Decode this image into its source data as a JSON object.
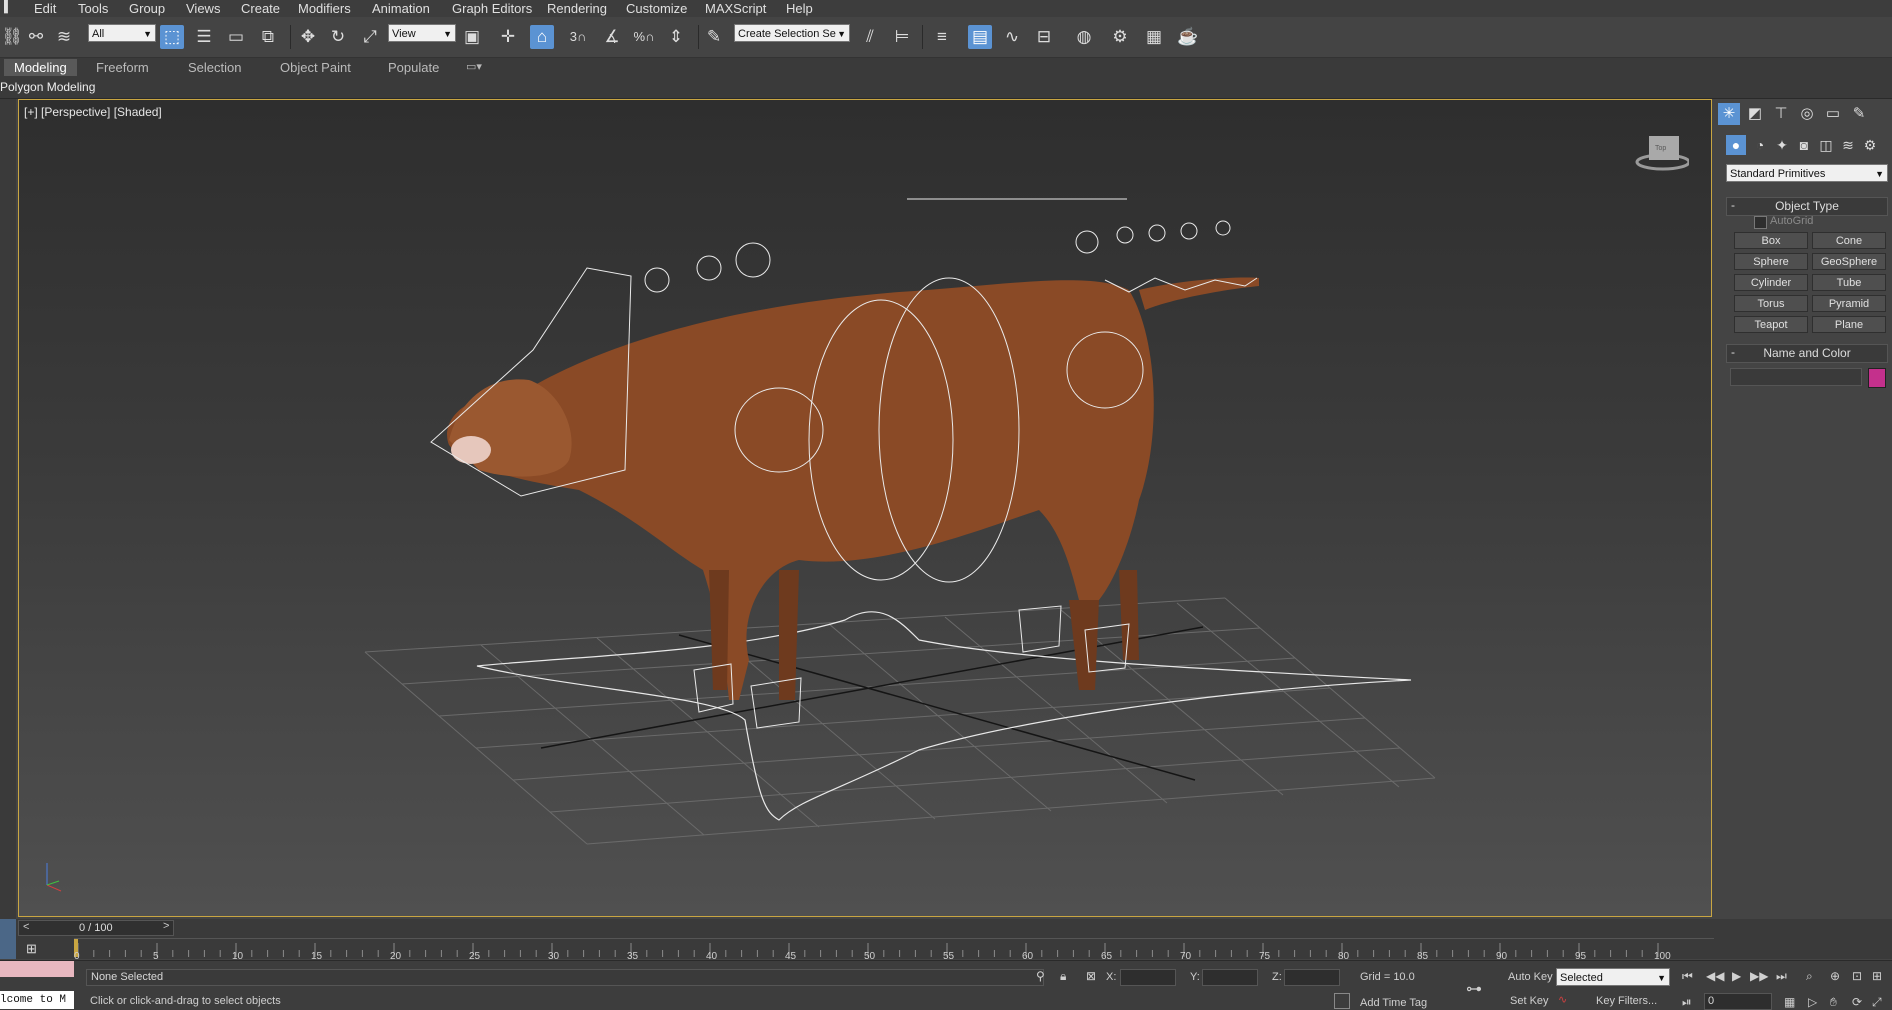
{
  "menu": {
    "items": [
      "Edit",
      "Tools",
      "Group",
      "Views",
      "Create",
      "Modifiers",
      "Animation",
      "Graph Editors",
      "Rendering",
      "Customize",
      "MAXScript",
      "Help"
    ]
  },
  "toolbar": {
    "selection_filter": "All",
    "reference_coord": "View",
    "named_selection": "Create Selection Se",
    "snap_3": "3",
    "snap_percent": "%"
  },
  "ribbon": {
    "tabs": [
      "Modeling",
      "Freeform",
      "Selection",
      "Object Paint",
      "Populate"
    ],
    "active_tab": "Modeling",
    "sub_label": "Polygon Modeling"
  },
  "viewport": {
    "label": "[+] [Perspective] [Shaded]",
    "viewcube_label": "Top"
  },
  "command_panel": {
    "category_dropdown": "Standard Primitives",
    "object_type_title": "Object Type",
    "autogrid_label": "AutoGrid",
    "buttons": [
      "Box",
      "Cone",
      "Sphere",
      "GeoSphere",
      "Cylinder",
      "Tube",
      "Torus",
      "Pyramid",
      "Teapot",
      "Plane"
    ],
    "name_color_title": "Name and Color",
    "name_value": "",
    "swatch_color": "#c4308c"
  },
  "timeline": {
    "frame_counter": "0 / 100",
    "ticks": [
      "0",
      "5",
      "10",
      "15",
      "20",
      "25",
      "30",
      "35",
      "40",
      "45",
      "50",
      "55",
      "60",
      "65",
      "70",
      "75",
      "80",
      "85",
      "90",
      "95",
      "100"
    ]
  },
  "status": {
    "selection_text": "None Selected",
    "prompt_text": "Click or click-and-drag to select objects",
    "maxscript_listener": "lcome to M",
    "x_label": "X:",
    "y_label": "Y:",
    "z_label": "Z:",
    "grid_text": "Grid = 10.0",
    "add_time_tag": "Add Time Tag",
    "auto_key": "Auto Key",
    "set_key": "Set Key",
    "selected_dropdown": "Selected",
    "key_filters": "Key Filters...",
    "current_frame": "0"
  },
  "colors": {
    "accent": "#5b93d3",
    "viewport_border": "#c9a642",
    "cow": "#8a4a26"
  }
}
